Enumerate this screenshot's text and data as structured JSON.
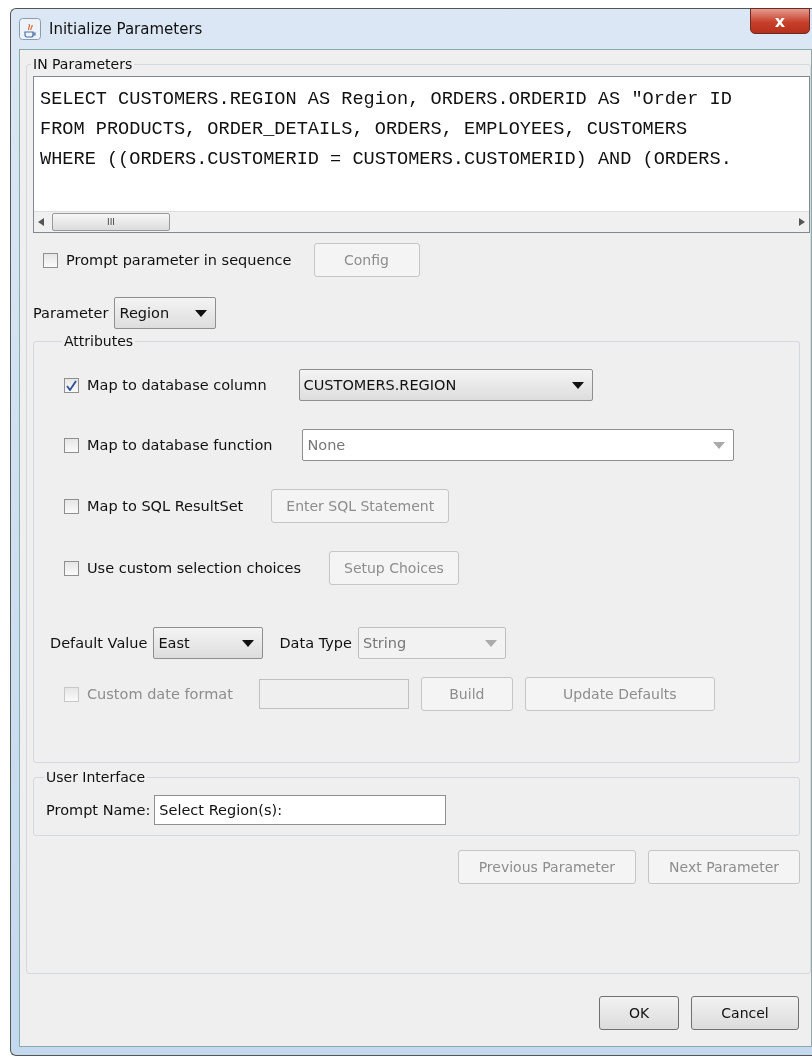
{
  "window": {
    "title": "Initialize Parameters",
    "close": "x"
  },
  "in_parameters": {
    "title": "IN Parameters",
    "sql_lines": [
      "SELECT CUSTOMERS.REGION AS Region, ORDERS.ORDERID AS \"Order ID",
      "FROM PRODUCTS, ORDER_DETAILS, ORDERS, EMPLOYEES, CUSTOMERS",
      "WHERE ((ORDERS.CUSTOMERID = CUSTOMERS.CUSTOMERID) AND (ORDERS."
    ],
    "scroll_grip": "III"
  },
  "prompt_in_sequence": {
    "label": "Prompt parameter in sequence",
    "checked": false
  },
  "config_button": {
    "label": "Config",
    "disabled": true
  },
  "parameter": {
    "label": "Parameter",
    "value": "Region"
  },
  "attributes": {
    "title": "Attributes",
    "mappings": [
      {
        "kind": "dropdown",
        "label": "Map to database column",
        "checked": true,
        "value": "CUSTOMERS.REGION"
      },
      {
        "kind": "combo",
        "label": "Map to database function",
        "checked": false,
        "value": "None"
      },
      {
        "kind": "button",
        "label": "Map to SQL ResultSet",
        "checked": false,
        "value": "Enter SQL Statement"
      },
      {
        "kind": "button",
        "label": "Use custom selection choices",
        "checked": false,
        "value": "Setup Choices"
      }
    ],
    "default_value": {
      "label": "Default Value",
      "value": "East"
    },
    "data_type": {
      "label": "Data Type",
      "value": "String",
      "disabled": true
    },
    "custom_date_format": {
      "label": "Custom date format",
      "checked": false,
      "disabled": true
    },
    "build_button": {
      "label": "Build",
      "disabled": true
    },
    "update_defaults_button": {
      "label": "Update Defaults",
      "disabled": true
    }
  },
  "user_interface": {
    "title": "User Interface",
    "prompt_name": {
      "label": "Prompt Name:",
      "value": "Select Region(s):"
    }
  },
  "nav_buttons": [
    {
      "label": "Previous Parameter",
      "disabled": true
    },
    {
      "label": "Next Parameter",
      "disabled": true
    }
  ],
  "dialog_buttons": [
    {
      "label": "OK",
      "disabled": false
    },
    {
      "label": "Cancel",
      "disabled": false
    }
  ]
}
